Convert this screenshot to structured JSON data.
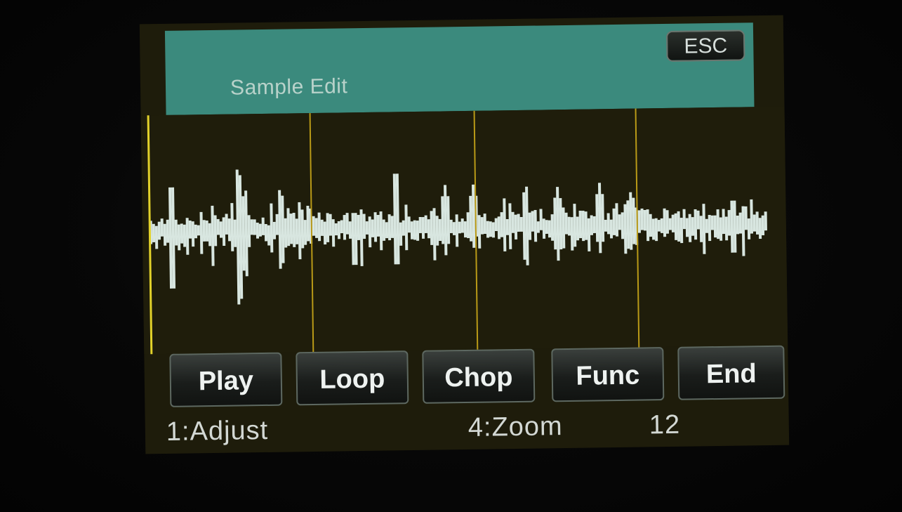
{
  "header": {
    "title": "Sample Edit",
    "esc_label": "ESC"
  },
  "buttons": [
    {
      "label": "Play"
    },
    {
      "label": "Loop"
    },
    {
      "label": "Chop"
    },
    {
      "label": "Func"
    },
    {
      "label": "End"
    }
  ],
  "footer": {
    "encoder1": "1:Adjust",
    "encoder4": "4:Zoom",
    "zoom_value": "12"
  },
  "colors": {
    "header": "#3b8a7d",
    "screen_bg": "#1e1c0b",
    "waveform": "#d8e6e0",
    "marker": "#b99a17",
    "start_marker": "#e2d22a"
  },
  "chop_markers_count": 4
}
